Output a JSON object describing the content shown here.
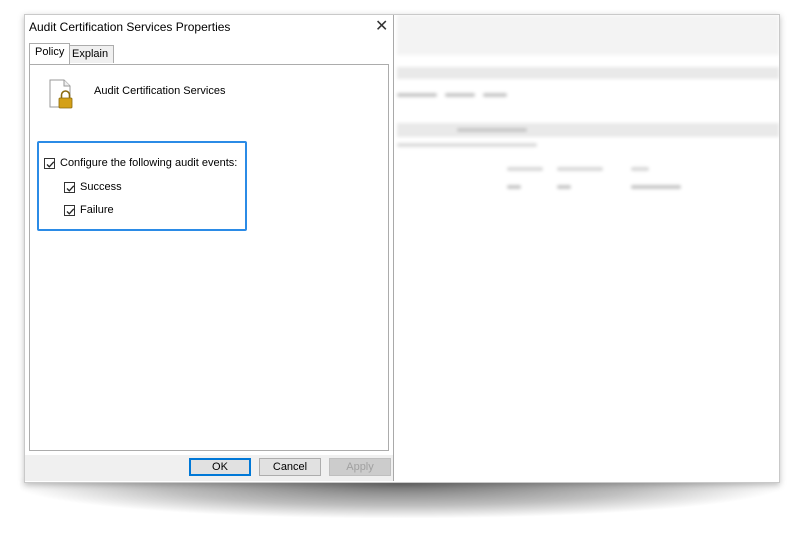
{
  "dialog": {
    "title": "Audit Certification Services Properties",
    "close_glyph": "✕",
    "tabs": [
      {
        "label": "Policy",
        "active": true
      },
      {
        "label": "Explain",
        "active": false
      }
    ],
    "policy_name": "Audit Certification Services",
    "policy_icon": "document-lock-icon",
    "audit": {
      "configure_label": "Configure the following audit events:",
      "configure_checked": true,
      "success_label": "Success",
      "success_checked": true,
      "failure_label": "Failure",
      "failure_checked": true
    },
    "buttons": {
      "ok": "OK",
      "cancel": "Cancel",
      "apply": "Apply"
    }
  },
  "colors": {
    "highlight_border": "#2b8be6",
    "default_button_border": "#0078d7",
    "lock_gold": "#d4a017"
  }
}
